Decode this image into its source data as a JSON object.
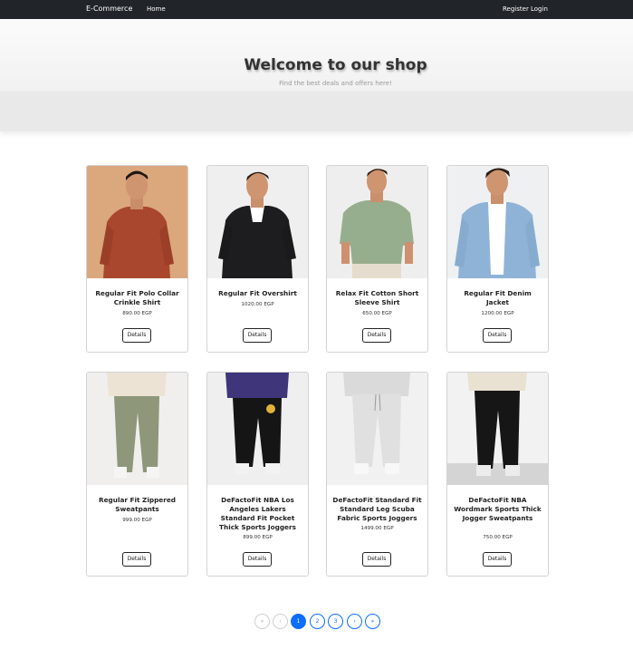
{
  "navbar": {
    "brand": "E-Commerce",
    "home": "Home",
    "register": "Register",
    "login": "Login"
  },
  "hero": {
    "title": "Welcome to our shop",
    "subtitle": "Find the best deals and offers here!"
  },
  "products": [
    {
      "title": "Regular Fit Polo Collar Crinkle Shirt",
      "price": "890.00 EGP",
      "button": "Details"
    },
    {
      "title": "Regular Fit Overshirt",
      "price": "1020.00 EGP",
      "button": "Details"
    },
    {
      "title": "Relax Fit Cotton Short Sleeve Shirt",
      "price": "650.00 EGP",
      "button": "Details"
    },
    {
      "title": "Regular Fit Denim Jacket",
      "price": "1200.00 EGP",
      "button": "Details"
    },
    {
      "title": "Regular Fit Zippered Sweatpants",
      "price": "999.00 EGP",
      "button": "Details"
    },
    {
      "title": "DeFactoFit NBA Los Angeles Lakers Standard Fit Pocket Thick Sports Joggers",
      "price": "899.00 EGP",
      "button": "Details"
    },
    {
      "title": "DeFactoFit Standard Fit Standard Leg Scuba Fabric Sports Joggers",
      "price": "1499.00 EGP",
      "button": "Details"
    },
    {
      "title": "DeFactoFit NBA Wordmark Sports Thick Jogger Sweatpants",
      "price": "750.00 EGP",
      "button": "Details"
    }
  ],
  "pagination": {
    "first": "«",
    "prev": "‹",
    "pages": [
      "1",
      "2",
      "3"
    ],
    "current": "1",
    "next": "›",
    "last": "»"
  }
}
